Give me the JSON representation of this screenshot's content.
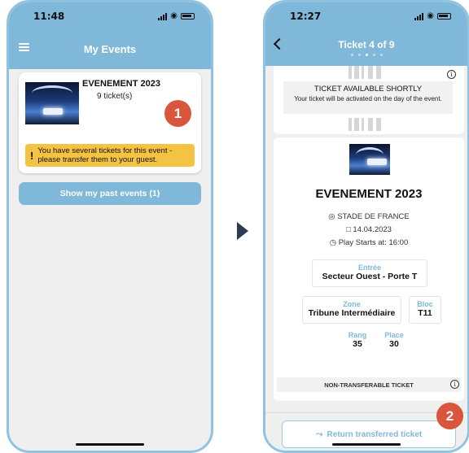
{
  "left_phone": {
    "status": {
      "time": "11:48"
    },
    "header": {
      "title": "My Events"
    },
    "event": {
      "title": "EVENEMENT 2023",
      "ticket_count": "9 ticket(s)",
      "warning_icon": "!",
      "warning_text": "You have several tickets for this event - please transfer them to your guest."
    },
    "past_events_button": "Show my past events (1)"
  },
  "callouts": {
    "one": "1",
    "two": "2"
  },
  "right_phone": {
    "status": {
      "time": "12:27"
    },
    "header": {
      "title": "Ticket 4 of 9"
    },
    "pager": {
      "current": 3,
      "total": 5
    },
    "availability": {
      "title": "TICKET AVAILABLE SHORTLY",
      "subtitle": "Your ticket will be activated on the day of the event."
    },
    "info_glyph": "i",
    "event": {
      "title": "EVENEMENT 2023",
      "venue": "STADE DE FRANCE",
      "date": "14.04.2023",
      "starts": "Play Starts at: 16:00"
    },
    "seating": {
      "entree_label": "Entrée",
      "entree_value": "Secteur Ouest - Porte T",
      "zone_label": "Zone",
      "zone_value": "Tribune Intermédiaire",
      "bloc_label": "Bloc",
      "bloc_value": "T11",
      "rang_label": "Rang",
      "rang_value": "35",
      "place_label": "Place",
      "place_value": "30"
    },
    "non_transferable": "NON-TRANSFERABLE TICKET",
    "return_button": "Return transferred ticket"
  },
  "colors": {
    "header": "#7fb8d8",
    "phone_frame": "#8fc3e0",
    "warning": "#f5c343",
    "callout": "#d9553c",
    "arrow": "#2b3d52"
  }
}
